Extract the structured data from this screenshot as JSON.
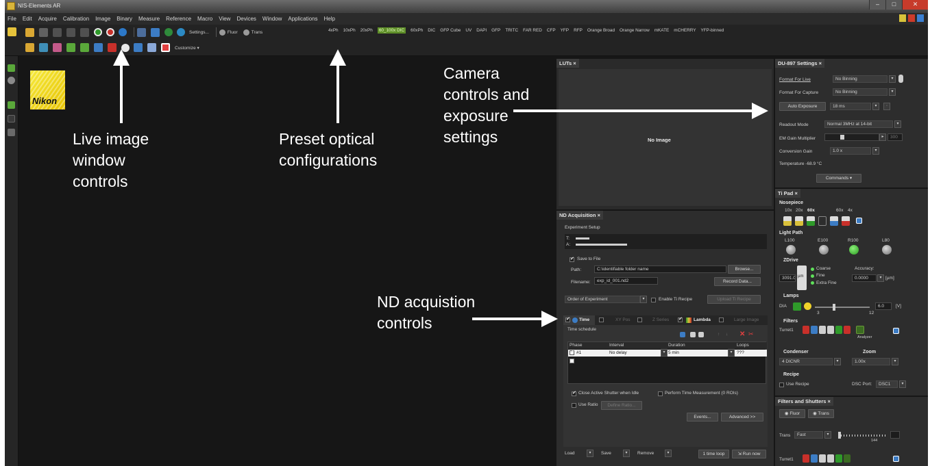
{
  "window": {
    "title": "NIS-Elements AR"
  },
  "menu": [
    "File",
    "Edit",
    "Acquire",
    "Calibration",
    "Image",
    "Binary",
    "Measure",
    "Reference",
    "Macro",
    "View",
    "Devices",
    "Window",
    "Applications",
    "Help"
  ],
  "toolbar": {
    "settings_label": "Settings...",
    "fluor_label": "Fluor",
    "trans_label": "Trans",
    "customize_label": "Customize",
    "optical_configs": [
      "4xPh",
      "10xPh",
      "20xPh",
      "60_100x DIC",
      "60xPh",
      "DIC",
      "GFP Cube",
      "UV",
      "DAPI",
      "GFP",
      "TRITC",
      "FAR RED",
      "CFP",
      "YFP",
      "RFP",
      "Orange Broad",
      "Orange Narrow",
      "mKATE",
      "mCHERRY",
      "YFP-binned"
    ],
    "selected_config": "60_100x DIC"
  },
  "logo": {
    "text": "Nikon"
  },
  "annotations": {
    "live": [
      "Live image",
      "window",
      "controls"
    ],
    "preset": [
      "Preset optical",
      "configurations"
    ],
    "camera": [
      "Camera",
      "controls and",
      "exposure",
      "settings"
    ],
    "nd": [
      "ND acquistion",
      "controls"
    ]
  },
  "luts": {
    "tab": "LUTs",
    "no_image": "No Image"
  },
  "nd": {
    "tab": "ND Acquisition",
    "setup": "Experiment Setup",
    "t_label": "T:",
    "a_label": "A:",
    "save_to_file": "Save to File",
    "path_label": "Path:",
    "path_value": "C:\\identifiable folder name",
    "browse": "Browse...",
    "filename_label": "Filename:",
    "filename_value": "exp_id_001.nd2",
    "record_data": "Record Data...",
    "order": "Order of Experiment",
    "enable_ti_recipe": "Enable Ti Recipe",
    "upload_ti_recipe": "Upload Ti Recipe",
    "tabs": [
      "Time",
      "XY Pos",
      "Z Series",
      "Lambda",
      "Large Image"
    ],
    "time_schedule": "Time schedule",
    "cols": [
      "Phase",
      "Interval",
      "Duration",
      "Loops"
    ],
    "row": {
      "phase": "#1",
      "interval": "No delay",
      "duration": "5 min",
      "loops": "???"
    },
    "close_shutter": "Close Active Shutter when Idle",
    "perform_time": "Perform Time Measurement (0 ROIs)",
    "use_ratio": "Use Ratio",
    "define_ratio": "Define Ratio...",
    "events": "Events...",
    "advanced": "Advanced >>",
    "load": "Load",
    "save": "Save",
    "remove": "Remove",
    "one_time_loop": "1 time loop",
    "run_now": "Run now"
  },
  "du": {
    "tab": "DU-897 Settings",
    "format_live_label": "Format For Live",
    "format_live": "No Binning",
    "format_capture_label": "Format For Capture",
    "format_capture": "No Binning",
    "auto_exposure": "Auto Exposure",
    "exposure": "18 ms",
    "readout_label": "Readout Mode",
    "readout": "Normal 3MHz at 14-bit",
    "em_gain_label": "EM Gain Multiplier",
    "em_gain_value": "300",
    "conv_gain_label": "Conversion Gain",
    "conv_gain": "1.0 x",
    "temperature": "Temperature -68.9 °C",
    "commands": "Commands"
  },
  "tipad": {
    "tab": "Ti Pad",
    "nosepiece": "Nosepiece",
    "objectives": [
      "10x",
      "20x",
      "60x",
      "60x",
      "4x"
    ],
    "light_path": "Light Path",
    "lp_items": [
      "L100",
      "E100",
      "R100",
      "L80"
    ],
    "zdrive": "ZDrive",
    "z_value": "3091.0",
    "um": "µm",
    "coarse": "Coarse",
    "fine": "Fine",
    "extra_fine": "Extra Fine",
    "accuracy_label": "Accuracy:",
    "accuracy": "0.0000",
    "accuracy_unit": "[µm]",
    "lamps": "Lamps",
    "dia": "DIA",
    "lamp_min": "3",
    "lamp_max": "12",
    "lamp_value": "6.0",
    "lamp_unit": "[V]",
    "filters": "Filters",
    "turret": "Turret1",
    "analyzer": "Analyzer",
    "condenser": "Condenser",
    "condenser_value": "4 DICNR",
    "zoom": "Zoom",
    "zoom_value": "1.00x",
    "recipe": "Recipe",
    "use_recipe": "Use Recipe",
    "dsc_port_label": "DSC Port:",
    "dsc_port": "DSC1"
  },
  "fs": {
    "tab": "Filters and Shutters",
    "fluor": "Fluor",
    "trans": "Trans",
    "trans_label": "Trans",
    "speed": "Fast",
    "slider_value": "144",
    "turret": "Turret1"
  }
}
